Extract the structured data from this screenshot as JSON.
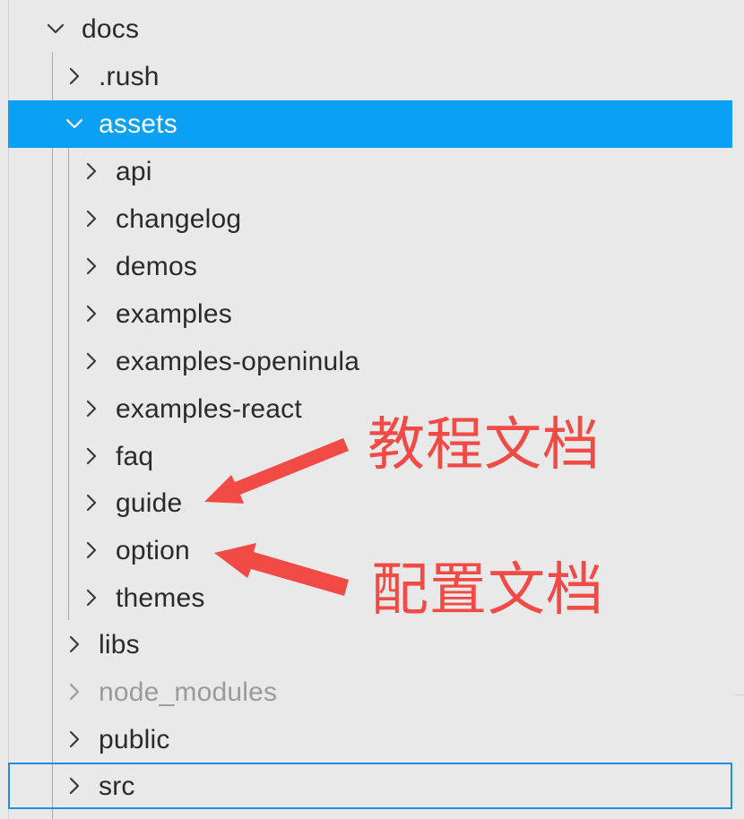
{
  "tree": {
    "items": [
      {
        "label": "docs",
        "expanded": true,
        "chevron_icon": "chevron-down-icon"
      },
      {
        "label": ".rush",
        "expanded": false,
        "chevron_icon": "chevron-right-icon"
      },
      {
        "label": "assets",
        "expanded": true,
        "selected": true,
        "chevron_icon": "chevron-down-icon"
      },
      {
        "label": "api",
        "expanded": false,
        "chevron_icon": "chevron-right-icon"
      },
      {
        "label": "changelog",
        "expanded": false,
        "chevron_icon": "chevron-right-icon"
      },
      {
        "label": "demos",
        "expanded": false,
        "chevron_icon": "chevron-right-icon"
      },
      {
        "label": "examples",
        "expanded": false,
        "chevron_icon": "chevron-right-icon"
      },
      {
        "label": "examples-openinula",
        "expanded": false,
        "chevron_icon": "chevron-right-icon"
      },
      {
        "label": "examples-react",
        "expanded": false,
        "chevron_icon": "chevron-right-icon"
      },
      {
        "label": "faq",
        "expanded": false,
        "chevron_icon": "chevron-right-icon"
      },
      {
        "label": "guide",
        "expanded": false,
        "chevron_icon": "chevron-right-icon"
      },
      {
        "label": "option",
        "expanded": false,
        "chevron_icon": "chevron-right-icon"
      },
      {
        "label": "themes",
        "expanded": false,
        "chevron_icon": "chevron-right-icon"
      },
      {
        "label": "libs",
        "expanded": false,
        "chevron_icon": "chevron-right-icon"
      },
      {
        "label": "node_modules",
        "expanded": false,
        "dimmed": true,
        "chevron_icon": "chevron-right-icon"
      },
      {
        "label": "public",
        "expanded": false,
        "chevron_icon": "chevron-right-icon"
      },
      {
        "label": "src",
        "expanded": false,
        "focused": true,
        "chevron_icon": "chevron-right-icon"
      }
    ]
  },
  "annotations": {
    "tutorial_docs": "教程文档",
    "config_docs": "配置文档"
  },
  "colors": {
    "background": "#e9e9ea",
    "selection": "#0aa0f3",
    "focus_outline": "#1f8fe6",
    "annotation_red": "#f24a45",
    "dimmed_text": "#9a9a9c"
  }
}
